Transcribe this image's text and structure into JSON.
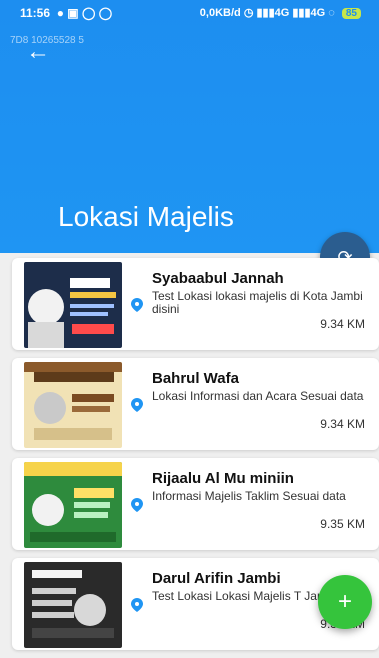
{
  "status_bar": {
    "time": "11:56",
    "right_text": "0,0KB/d",
    "battery": "85"
  },
  "header": {
    "sticker": "7D8 10265528 5",
    "title": "Lokasi Majelis",
    "colors": {
      "header_blue": "#1f95f3",
      "fab_dark": "#2b5d8f",
      "fab_green": "#35c43c"
    }
  },
  "cards": [
    {
      "title": "Syabaabul Jannah",
      "subtitle": "Test Lokasi lokasi majelis di Kota Jambi disini",
      "distance": "9.34 KM"
    },
    {
      "title": "Bahrul Wafa",
      "subtitle": "Lokasi Informasi dan Acara Sesuai data",
      "distance": "9.34 KM"
    },
    {
      "title": "Rijaalu Al Mu miniin",
      "subtitle": "Informasi Majelis Taklim Sesuai data",
      "distance": "9.35 KM"
    },
    {
      "title": "Darul Arifin Jambi",
      "subtitle": "Test Lokasi Lokasi Majelis T Jambi",
      "distance": "9.35 KM"
    }
  ],
  "icons": {
    "back": "back-arrow-icon",
    "refresh": "refresh-icon",
    "add": "add-icon",
    "pin": "location-pin-icon"
  }
}
